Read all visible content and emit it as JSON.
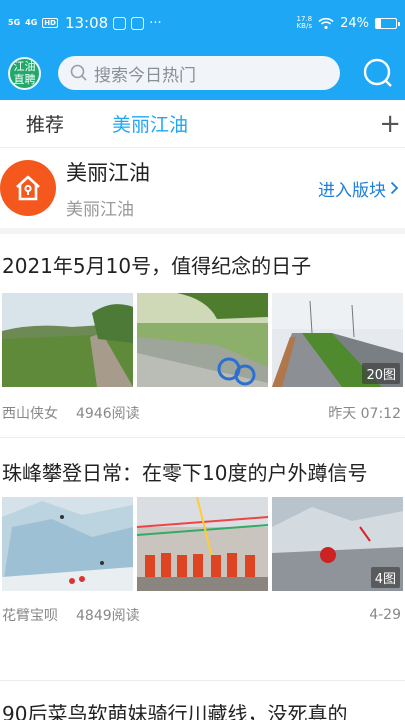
{
  "status_bar": {
    "signal1": "5G",
    "signal2": "4G",
    "hd": "HD",
    "time": "13:08",
    "net_speed_value": "17.8",
    "net_speed_unit": "KB/s",
    "battery_percent": "24%",
    "battery_level": 0.24
  },
  "header": {
    "logo_line1": "江油",
    "logo_line2": "直聘",
    "search_placeholder": "搜索今日热门"
  },
  "tabs": [
    {
      "label": "推荐",
      "active": false
    },
    {
      "label": "美丽江油",
      "active": true
    }
  ],
  "tab_add": "+",
  "board": {
    "name": "美丽江油",
    "subtitle": "美丽江油",
    "enter_label": "进入版块"
  },
  "articles": [
    {
      "title": "2021年5月10号，值得纪念的日子",
      "author": "西山侠女",
      "views": "4946阅读",
      "time": "昨天 07:12",
      "image_count": "20图"
    },
    {
      "title": "珠峰攀登日常：在零下10度的户外蹲信号",
      "author": "花臂宝呗",
      "views": "4849阅读",
      "time": "4-29",
      "image_count": "4图"
    },
    {
      "title": "90后菜鸟软萌妹骑行川藏线，没死真的"
    }
  ],
  "colors": {
    "brand_blue": "#1ea7f5",
    "board_orange": "#f5581c",
    "link_blue": "#1e7fd9"
  }
}
